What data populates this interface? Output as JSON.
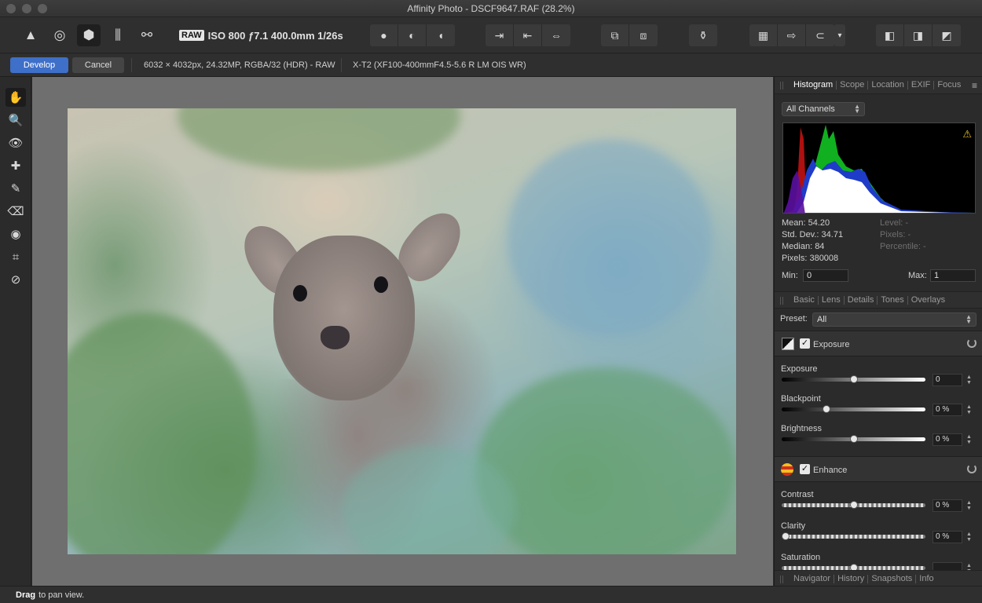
{
  "window": {
    "title": "Affinity Photo - DSCF9647.RAF (28.2%)"
  },
  "toolbar": {
    "personas": [
      {
        "name": "photo-persona-icon",
        "glyph": "▲"
      },
      {
        "name": "liquify-persona-icon",
        "glyph": "◎"
      },
      {
        "name": "develop-persona-icon",
        "glyph": "⬢"
      },
      {
        "name": "tone-mapping-persona-icon",
        "glyph": "⫼"
      },
      {
        "name": "export-persona-icon",
        "glyph": "⚯"
      }
    ],
    "raw_badge": "RAW",
    "exif_summary": "ISO 800 ƒ7.1 400.0mm 1/26s",
    "view_group": [
      "●",
      "◐",
      "◖"
    ],
    "split_group": [
      "⇥",
      "⇤",
      "⇔"
    ],
    "compare_group": [
      "⧉",
      "⧈"
    ],
    "dropper": "⚱",
    "overlay_group": [
      "▦",
      "⇨",
      "⊂"
    ],
    "more": "▾",
    "clip_group": [
      "◧",
      "◨",
      "◩"
    ]
  },
  "context": {
    "develop_label": "Develop",
    "cancel_label": "Cancel",
    "image_info": "6032 × 4032px, 24.32MP, RGBA/32 (HDR) - RAW",
    "camera_info": "X-T2 (XF100-400mmF4.5-5.6 R LM OIS WR)"
  },
  "tools": [
    {
      "name": "view-tool-icon",
      "glyph": "✋",
      "active": true
    },
    {
      "name": "zoom-tool-icon",
      "glyph": "🔍"
    },
    {
      "name": "red-eye-tool-icon",
      "glyph": "👁"
    },
    {
      "name": "blemish-tool-icon",
      "glyph": "✚"
    },
    {
      "name": "overlay-paint-tool-icon",
      "glyph": "✎"
    },
    {
      "name": "overlay-erase-tool-icon",
      "glyph": "⌫"
    },
    {
      "name": "overlay-gradient-tool-icon",
      "glyph": "◉"
    },
    {
      "name": "crop-tool-icon",
      "glyph": "⌗"
    },
    {
      "name": "white-balance-tool-icon",
      "glyph": "⊘"
    }
  ],
  "histogram_panel": {
    "tabs": [
      "Histogram",
      "Scope",
      "Location",
      "EXIF",
      "Focus"
    ],
    "channel_select": "All Channels",
    "stats": {
      "mean": "Mean: 54.20",
      "std_dev": "Std. Dev.: 34.71",
      "median": "Median: 84",
      "pixels": "Pixels: 380008",
      "level": "Level: -",
      "pixels_sel": "Pixels: -",
      "percentile": "Percentile: -"
    },
    "min_label": "Min:",
    "min_value": "0",
    "max_label": "Max:",
    "max_value": "1",
    "warning_icon": "⚠"
  },
  "develop_panel": {
    "tabs": [
      "Basic",
      "Lens",
      "Details",
      "Tones",
      "Overlays"
    ],
    "preset_label": "Preset:",
    "preset_value": "All",
    "exposure_section": {
      "title": "Exposure",
      "sliders": [
        {
          "label": "Exposure",
          "value": "0",
          "pos": 0.5,
          "track": "gradient"
        },
        {
          "label": "Blackpoint",
          "value": "0 %",
          "pos": 0.3,
          "track": "gradient"
        },
        {
          "label": "Brightness",
          "value": "0 %",
          "pos": 0.5,
          "track": "gradient"
        }
      ]
    },
    "enhance_section": {
      "title": "Enhance",
      "sliders": [
        {
          "label": "Contrast",
          "value": "0 %",
          "pos": 0.5,
          "track": "checker"
        },
        {
          "label": "Clarity",
          "value": "0 %",
          "pos": 0.0,
          "track": "checker"
        },
        {
          "label": "Saturation",
          "value": "",
          "pos": 0.5,
          "track": "checker"
        }
      ]
    }
  },
  "bottom_tabs": [
    "Navigator",
    "History",
    "Snapshots",
    "Info"
  ],
  "status": {
    "bold": "Drag",
    "text": "to pan view."
  }
}
